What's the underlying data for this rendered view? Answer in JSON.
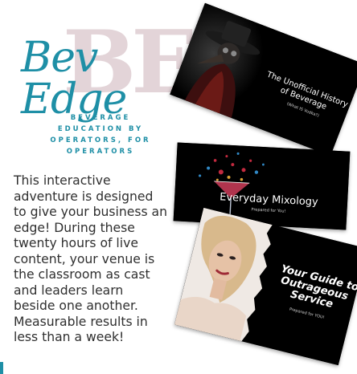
{
  "colors": {
    "teal": "#1e8fa6",
    "pink_be": "#e3d4d8",
    "card_bg": "#000000",
    "card_white": "#ffffff",
    "body_text": "#2f2f2f"
  },
  "logo": {
    "background_letters": "BE",
    "script": "Bev Edge"
  },
  "tagline": [
    "BEVERAGE",
    "EDUCATION BY",
    "OPERATORS, FOR",
    "OPERATORS"
  ],
  "description": [
    "This interactive",
    "adventure is designed",
    "to give your business an",
    "edge! During these",
    "twenty hours of live",
    "content, your venue is",
    "the classroom as cast",
    "and leaders learn",
    "beside one another.",
    "Measurable results in",
    "less than a week!"
  ],
  "cards": [
    {
      "title_line1": "The Unofficial History",
      "title_line2": "of Beverage",
      "subtitle": "(What IS Vodka?)",
      "image": "plague-doctor-image"
    },
    {
      "title": "Everyday Mixology",
      "subtitle": "Prepared for You!",
      "image": "splashing-cocktail-image"
    },
    {
      "title_line1": "Your Guide to",
      "title_line2": "Outrageous",
      "title_line3": "Service",
      "subtitle": "Prepared for YOU!",
      "image": "woman-bowtie-portrait-image"
    }
  ]
}
